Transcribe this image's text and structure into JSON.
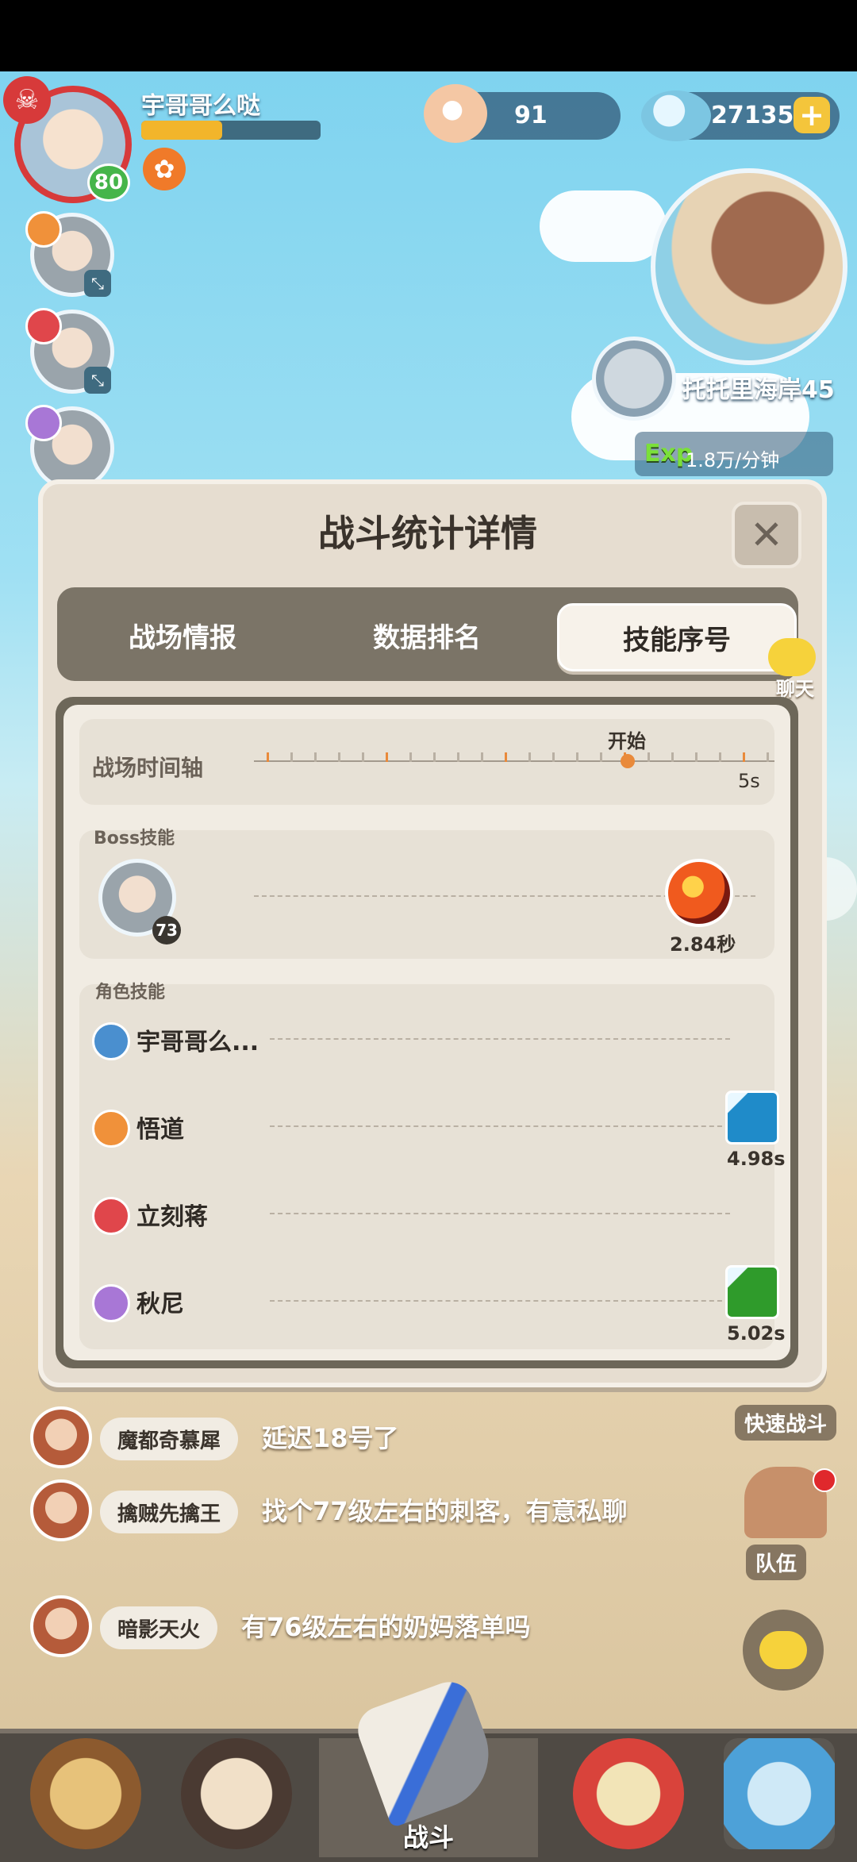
{
  "player": {
    "name": "宇哥哥么哒",
    "level": "80",
    "xp_fraction": 0.45
  },
  "currency": {
    "pearls": "91",
    "crystals": "27135"
  },
  "map": {
    "location": "托托里海岸45",
    "exp_label": "Exp",
    "exp_rate": "1.8万/分钟"
  },
  "modal": {
    "title": "战斗统计详情",
    "close_icon": "close-icon",
    "tabs": [
      {
        "label": "战场情报",
        "active": false
      },
      {
        "label": "数据排名",
        "active": false
      },
      {
        "label": "技能序号",
        "active": true
      }
    ],
    "timeline": {
      "label": "战场时间轴",
      "start_label": "开始",
      "end_label": "5s"
    },
    "boss": {
      "section_label": "Boss技能",
      "level": "73",
      "skill_time": "2.84秒"
    },
    "roles": {
      "section_label": "角色技能",
      "items": [
        {
          "name": "宇哥哥么...",
          "color": "#4a8fcf",
          "skill_time": ""
        },
        {
          "name": "悟道",
          "color": "#f0913a",
          "skill_time": "4.98s"
        },
        {
          "name": "立刻蒋",
          "color": "#e0464b",
          "skill_time": ""
        },
        {
          "name": "秋尼",
          "color": "#a877d6",
          "skill_time": "5.02s"
        }
      ]
    }
  },
  "chat_float": {
    "label": "聊天"
  },
  "right_buttons": {
    "quick_battle": "快速战斗",
    "team": "队伍"
  },
  "chat": [
    {
      "name": "魔都奇慕犀",
      "message": "延迟18号了"
    },
    {
      "name": "擒贼先擒王",
      "message": "找个77级左右的刺客，有意私聊"
    },
    {
      "name": "暗影天火",
      "message": "有76级左右的奶妈落单吗"
    }
  ],
  "nav": {
    "center_label": "战斗"
  }
}
